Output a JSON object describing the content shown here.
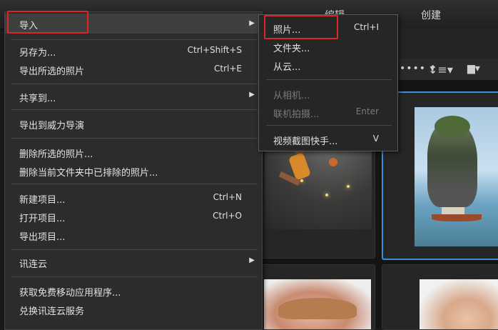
{
  "top_tabs": [
    {
      "label": "编辑"
    },
    {
      "label": "创建"
    }
  ],
  "toolbar": {
    "dots_icon": "more-dots-icon",
    "lines_icon": "line-spacing-icon",
    "square_icon": "layers-icon"
  },
  "main_menu": {
    "items": [
      {
        "label": "导入",
        "submenu": true,
        "selected": true
      },
      {
        "label": "另存为...",
        "shortcut": "Ctrl+Shift+S"
      },
      {
        "label": "导出所选的照片",
        "shortcut": "Ctrl+E"
      },
      {
        "label": "共享到...",
        "submenu": true
      },
      {
        "label": "导出到威力导演"
      },
      {
        "label": "删除所选的照片..."
      },
      {
        "label": "删除当前文件夹中已排除的照片..."
      },
      {
        "label": "新建项目...",
        "shortcut": "Ctrl+N"
      },
      {
        "label": "打开项目...",
        "shortcut": "Ctrl+O"
      },
      {
        "label": "导出项目..."
      },
      {
        "label": "讯连云",
        "submenu": true
      },
      {
        "label": "获取免费移动应用程序..."
      },
      {
        "label": "兑换讯连云服务"
      }
    ]
  },
  "sub_menu": {
    "items": [
      {
        "label": "照片...",
        "shortcut": "Ctrl+I",
        "selected": true
      },
      {
        "label": "文件夹..."
      },
      {
        "label": "从云..."
      },
      {
        "label": "从相机...",
        "disabled": true
      },
      {
        "label": "联机拍摄...",
        "shortcut": "Enter",
        "disabled": true
      },
      {
        "label": "视频截图快手...",
        "shortcut": "V"
      }
    ]
  },
  "colors": {
    "highlight_box": "#e0242b",
    "selection_border": "#3d8ed8"
  }
}
